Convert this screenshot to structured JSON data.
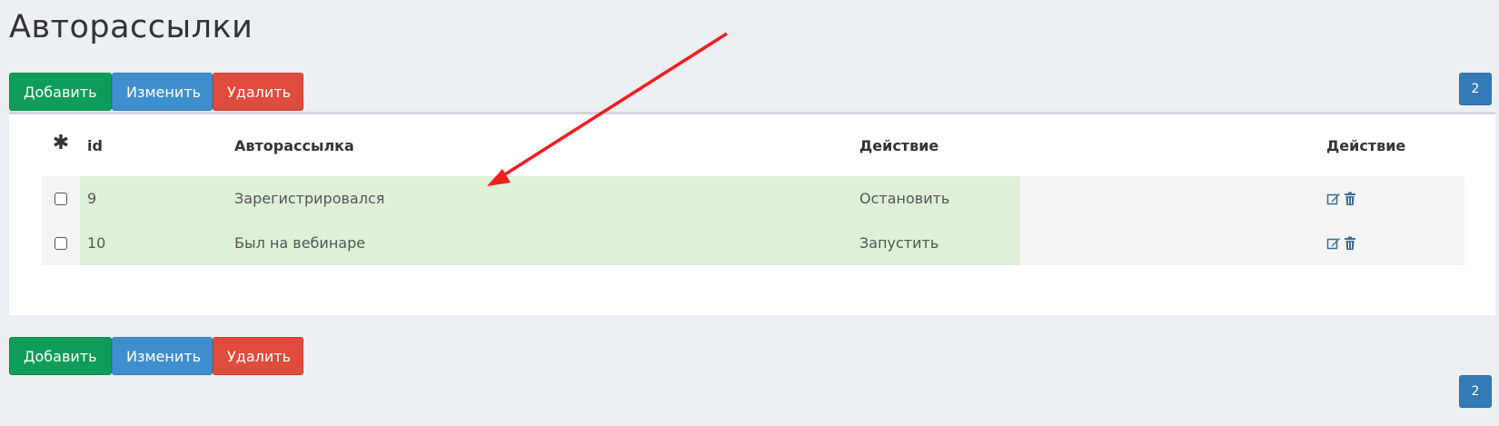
{
  "page": {
    "title": "Авторассылки"
  },
  "toolbar": {
    "add_label": "Добавить",
    "edit_label": "Изменить",
    "delete_label": "Удалить"
  },
  "pagination": {
    "page": "2"
  },
  "table": {
    "select_all_symbol": "✱",
    "columns": [
      "id",
      "Авторассылка",
      "Действие",
      "Действие"
    ],
    "rows": [
      {
        "id": "9",
        "name": "Зарегистрировался",
        "action": "Остановить"
      },
      {
        "id": "10",
        "name": "Был на вебинаре",
        "action": "Запустить"
      }
    ]
  },
  "colors": {
    "add": "#0d9d58",
    "edit": "#3f8fcf",
    "delete": "#df4b3c",
    "highlight": "#dff0d8",
    "pager": "#337ab7"
  },
  "icons": {
    "edit": "edit-icon",
    "delete": "trash-icon"
  }
}
